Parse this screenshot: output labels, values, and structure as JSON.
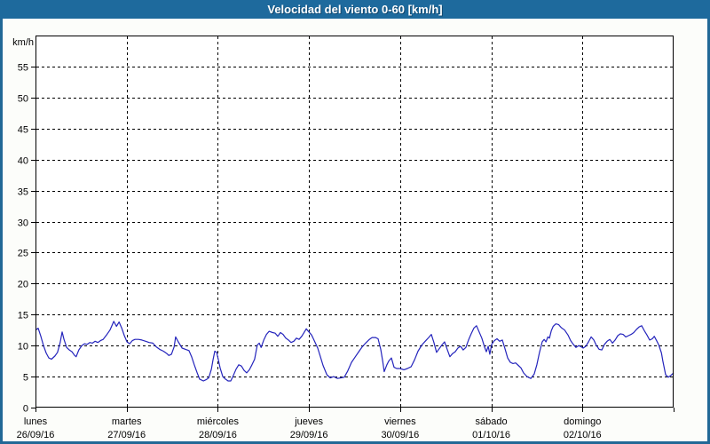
{
  "window": {
    "title": "Velocidad del viento 0-60 [km/h]"
  },
  "colors": {
    "titlebar_bg": "#1e6a9d",
    "titlebar_text": "#ffffff",
    "frame_border": "#226896",
    "page_bg": "#fcfdfa",
    "plot_bg": "#ffffff",
    "grid": "#000000",
    "axis": "#000000",
    "tick_text": "#000000",
    "line": "#2424bc"
  },
  "chart_data": {
    "type": "line",
    "title": "Velocidad del viento 0-60 [km/h]",
    "xlabel": "",
    "ylabel": "km/h",
    "ylim": [
      0,
      60
    ],
    "ytick_step": 5,
    "ytick_labels": [
      "0",
      "5",
      "10",
      "15",
      "20",
      "25",
      "30",
      "35",
      "40",
      "45",
      "50",
      "55"
    ],
    "grid": true,
    "legend_position": "none",
    "x_range_hours": [
      0,
      168
    ],
    "day_ticks": [
      {
        "name": "lunes",
        "date": "26/09/16"
      },
      {
        "name": "martes",
        "date": "27/09/16"
      },
      {
        "name": "miércoles",
        "date": "28/09/16"
      },
      {
        "name": "jueves",
        "date": "29/09/16"
      },
      {
        "name": "viernes",
        "date": "30/09/16"
      },
      {
        "name": "sábado",
        "date": "01/10/16"
      },
      {
        "name": "domingo",
        "date": "02/10/16"
      }
    ],
    "series": [
      {
        "name": "Velocidad del viento",
        "unit": "km/h",
        "color": "#2424bc",
        "points": [
          [
            0,
            12.5
          ],
          [
            0.7,
            12.8
          ],
          [
            1.4,
            11.5
          ],
          [
            2.1,
            10.0
          ],
          [
            2.8,
            8.8
          ],
          [
            3.5,
            8.0
          ],
          [
            4.2,
            7.8
          ],
          [
            5.1,
            8.3
          ],
          [
            5.8,
            8.9
          ],
          [
            6.5,
            10.5
          ],
          [
            7.0,
            12.2
          ],
          [
            7.5,
            11.0
          ],
          [
            8.2,
            9.7
          ],
          [
            8.9,
            9.3
          ],
          [
            9.6,
            9.0
          ],
          [
            10.3,
            8.4
          ],
          [
            10.7,
            8.2
          ],
          [
            11.4,
            9.3
          ],
          [
            12.2,
            10.0
          ],
          [
            12.9,
            10.3
          ],
          [
            13.6,
            10.2
          ],
          [
            14.3,
            10.5
          ],
          [
            15.0,
            10.4
          ],
          [
            15.7,
            10.7
          ],
          [
            16.4,
            10.5
          ],
          [
            17.1,
            10.8
          ],
          [
            17.8,
            11.0
          ],
          [
            18.7,
            11.7
          ],
          [
            19.6,
            12.5
          ],
          [
            20.6,
            13.9
          ],
          [
            21.3,
            13.1
          ],
          [
            22.0,
            13.8
          ],
          [
            22.7,
            12.8
          ],
          [
            23.4,
            11.6
          ],
          [
            24.1,
            10.6
          ],
          [
            24.8,
            10.3
          ],
          [
            25.5,
            10.8
          ],
          [
            26.2,
            11.0
          ],
          [
            27.1,
            11.0
          ],
          [
            28.0,
            10.9
          ],
          [
            29.0,
            10.7
          ],
          [
            29.9,
            10.5
          ],
          [
            30.9,
            10.4
          ],
          [
            31.8,
            9.8
          ],
          [
            32.7,
            9.4
          ],
          [
            33.7,
            9.1
          ],
          [
            34.6,
            8.7
          ],
          [
            35.1,
            8.4
          ],
          [
            35.8,
            8.6
          ],
          [
            36.5,
            9.8
          ],
          [
            36.9,
            11.4
          ],
          [
            37.6,
            10.6
          ],
          [
            38.6,
            9.6
          ],
          [
            39.5,
            9.4
          ],
          [
            40.4,
            9.2
          ],
          [
            41.1,
            8.2
          ],
          [
            41.8,
            6.9
          ],
          [
            42.5,
            5.7
          ],
          [
            43.2,
            4.6
          ],
          [
            44.2,
            4.3
          ],
          [
            44.9,
            4.5
          ],
          [
            45.6,
            4.8
          ],
          [
            46.3,
            6.2
          ],
          [
            46.7,
            7.6
          ],
          [
            47.2,
            9.1
          ],
          [
            47.7,
            8.9
          ],
          [
            48.1,
            7.8
          ],
          [
            48.6,
            6.4
          ],
          [
            49.3,
            5.0
          ],
          [
            50.0,
            4.6
          ],
          [
            50.7,
            4.3
          ],
          [
            51.4,
            4.3
          ],
          [
            52.1,
            5.2
          ],
          [
            52.8,
            6.2
          ],
          [
            53.5,
            6.9
          ],
          [
            54.2,
            6.7
          ],
          [
            54.9,
            6.0
          ],
          [
            55.6,
            5.6
          ],
          [
            56.3,
            6.1
          ],
          [
            57.0,
            6.9
          ],
          [
            57.7,
            7.8
          ],
          [
            58.4,
            10.1
          ],
          [
            58.9,
            10.4
          ],
          [
            59.4,
            9.7
          ],
          [
            60.1,
            10.9
          ],
          [
            60.8,
            11.8
          ],
          [
            61.5,
            12.3
          ],
          [
            62.4,
            12.1
          ],
          [
            63.1,
            12.0
          ],
          [
            63.8,
            11.5
          ],
          [
            64.5,
            12.1
          ],
          [
            65.2,
            11.8
          ],
          [
            65.9,
            11.2
          ],
          [
            66.6,
            10.9
          ],
          [
            67.3,
            10.5
          ],
          [
            68.0,
            10.7
          ],
          [
            68.7,
            11.2
          ],
          [
            69.4,
            11.0
          ],
          [
            70.1,
            11.5
          ],
          [
            70.8,
            12.2
          ],
          [
            71.3,
            12.7
          ],
          [
            72.0,
            12.2
          ],
          [
            72.7,
            11.7
          ],
          [
            73.4,
            10.8
          ],
          [
            74.3,
            9.6
          ],
          [
            75.0,
            8.2
          ],
          [
            75.7,
            6.8
          ],
          [
            76.7,
            5.3
          ],
          [
            77.6,
            4.8
          ],
          [
            78.5,
            5.0
          ],
          [
            79.5,
            4.7
          ],
          [
            80.4,
            4.8
          ],
          [
            81.3,
            4.9
          ],
          [
            82.2,
            5.9
          ],
          [
            83.2,
            7.3
          ],
          [
            84.1,
            8.1
          ],
          [
            85.1,
            9.0
          ],
          [
            86.0,
            9.8
          ],
          [
            86.9,
            10.4
          ],
          [
            87.9,
            11.0
          ],
          [
            88.6,
            11.3
          ],
          [
            89.5,
            11.3
          ],
          [
            90.2,
            11.1
          ],
          [
            90.9,
            9.4
          ],
          [
            91.4,
            7.5
          ],
          [
            91.8,
            5.8
          ],
          [
            92.5,
            6.9
          ],
          [
            93.0,
            7.5
          ],
          [
            93.7,
            8.0
          ],
          [
            94.4,
            6.5
          ],
          [
            95.1,
            6.3
          ],
          [
            96.0,
            6.3
          ],
          [
            97.0,
            6.1
          ],
          [
            97.9,
            6.3
          ],
          [
            98.9,
            6.6
          ],
          [
            99.8,
            7.7
          ],
          [
            100.7,
            9.1
          ],
          [
            101.7,
            10.1
          ],
          [
            102.6,
            10.7
          ],
          [
            103.5,
            11.3
          ],
          [
            104.2,
            11.8
          ],
          [
            104.9,
            10.5
          ],
          [
            105.6,
            8.9
          ],
          [
            106.3,
            9.5
          ],
          [
            107.0,
            10.1
          ],
          [
            107.7,
            10.6
          ],
          [
            108.4,
            9.4
          ],
          [
            109.1,
            8.2
          ],
          [
            109.8,
            8.7
          ],
          [
            110.5,
            9.0
          ],
          [
            111.2,
            9.6
          ],
          [
            111.9,
            9.9
          ],
          [
            112.6,
            9.3
          ],
          [
            113.3,
            9.7
          ],
          [
            114.0,
            10.9
          ],
          [
            114.7,
            11.9
          ],
          [
            115.4,
            12.8
          ],
          [
            116.1,
            13.2
          ],
          [
            116.8,
            12.2
          ],
          [
            117.5,
            11.2
          ],
          [
            118.2,
            9.8
          ],
          [
            118.7,
            9.0
          ],
          [
            119.2,
            9.9
          ],
          [
            119.6,
            8.6
          ],
          [
            120.1,
            10.2
          ],
          [
            120.8,
            10.8
          ],
          [
            121.5,
            11.1
          ],
          [
            122.2,
            10.7
          ],
          [
            122.9,
            10.9
          ],
          [
            123.6,
            9.5
          ],
          [
            124.3,
            8.0
          ],
          [
            125.0,
            7.3
          ],
          [
            125.7,
            7.1
          ],
          [
            126.4,
            7.2
          ],
          [
            127.1,
            6.8
          ],
          [
            127.8,
            6.4
          ],
          [
            128.5,
            5.6
          ],
          [
            129.4,
            5.0
          ],
          [
            130.4,
            4.7
          ],
          [
            131.3,
            5.4
          ],
          [
            132.0,
            6.9
          ],
          [
            132.7,
            8.9
          ],
          [
            133.4,
            10.6
          ],
          [
            133.9,
            11.0
          ],
          [
            134.4,
            10.6
          ],
          [
            134.9,
            11.4
          ],
          [
            135.3,
            11.2
          ],
          [
            135.8,
            12.4
          ],
          [
            136.3,
            13.1
          ],
          [
            137.0,
            13.5
          ],
          [
            137.7,
            13.4
          ],
          [
            138.4,
            12.9
          ],
          [
            139.3,
            12.5
          ],
          [
            140.2,
            11.7
          ],
          [
            140.9,
            10.8
          ],
          [
            141.6,
            10.2
          ],
          [
            142.3,
            9.7
          ],
          [
            143.0,
            10.0
          ],
          [
            143.7,
            9.8
          ],
          [
            144.2,
            9.6
          ],
          [
            144.9,
            9.9
          ],
          [
            145.6,
            10.6
          ],
          [
            146.3,
            11.4
          ],
          [
            147.0,
            10.9
          ],
          [
            147.7,
            10.0
          ],
          [
            148.4,
            9.4
          ],
          [
            149.1,
            9.3
          ],
          [
            149.8,
            10.2
          ],
          [
            150.5,
            10.7
          ],
          [
            151.2,
            11.0
          ],
          [
            151.9,
            10.4
          ],
          [
            152.6,
            10.9
          ],
          [
            153.3,
            11.6
          ],
          [
            154.0,
            11.9
          ],
          [
            154.7,
            11.8
          ],
          [
            155.4,
            11.4
          ],
          [
            156.1,
            11.6
          ],
          [
            156.8,
            11.8
          ],
          [
            157.5,
            12.1
          ],
          [
            158.2,
            12.6
          ],
          [
            158.9,
            13.0
          ],
          [
            159.6,
            13.2
          ],
          [
            160.3,
            12.4
          ],
          [
            161.0,
            11.7
          ],
          [
            161.7,
            10.9
          ],
          [
            162.4,
            11.1
          ],
          [
            162.9,
            11.5
          ],
          [
            163.6,
            10.7
          ],
          [
            164.1,
            10.1
          ],
          [
            164.8,
            8.8
          ],
          [
            165.2,
            7.4
          ],
          [
            165.9,
            5.3
          ],
          [
            166.6,
            4.9
          ],
          [
            167.3,
            5.2
          ],
          [
            168.0,
            5.6
          ]
        ]
      }
    ]
  }
}
